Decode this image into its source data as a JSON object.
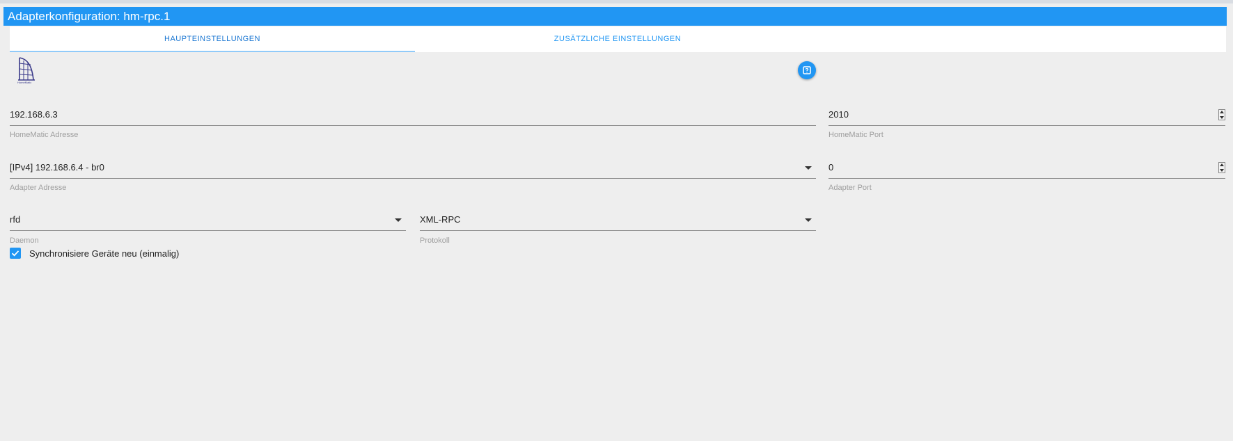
{
  "window": {
    "title": "Adapterkonfiguration: hm-rpc.1"
  },
  "tabs": [
    {
      "label": "HAUPTEINSTELLUNGEN",
      "active": true
    },
    {
      "label": "ZUSÄTZLICHE EINSTELLUNGEN",
      "active": false
    }
  ],
  "logo": {
    "icon": "homematic-logo-icon",
    "text": "HomeMatic"
  },
  "help": {
    "icon": "help-icon"
  },
  "fields": {
    "homematic_address": {
      "value": "192.168.6.3",
      "label": "HomeMatic Adresse"
    },
    "homematic_port": {
      "value": "2010",
      "label": "HomeMatic Port"
    },
    "adapter_address": {
      "value": "[IPv4] 192.168.6.4 - br0",
      "label": "Adapter Adresse"
    },
    "adapter_port": {
      "value": "0",
      "label": "Adapter Port"
    },
    "daemon": {
      "value": "rfd",
      "label": "Daemon"
    },
    "protocol": {
      "value": "XML-RPC",
      "label": "Protokoll"
    }
  },
  "sync_devices": {
    "checked": true,
    "label": "Synchronisiere Geräte neu (einmalig)"
  },
  "colors": {
    "accent": "#2196f3",
    "background": "#eeeeee",
    "label": "#9e9e9e"
  }
}
